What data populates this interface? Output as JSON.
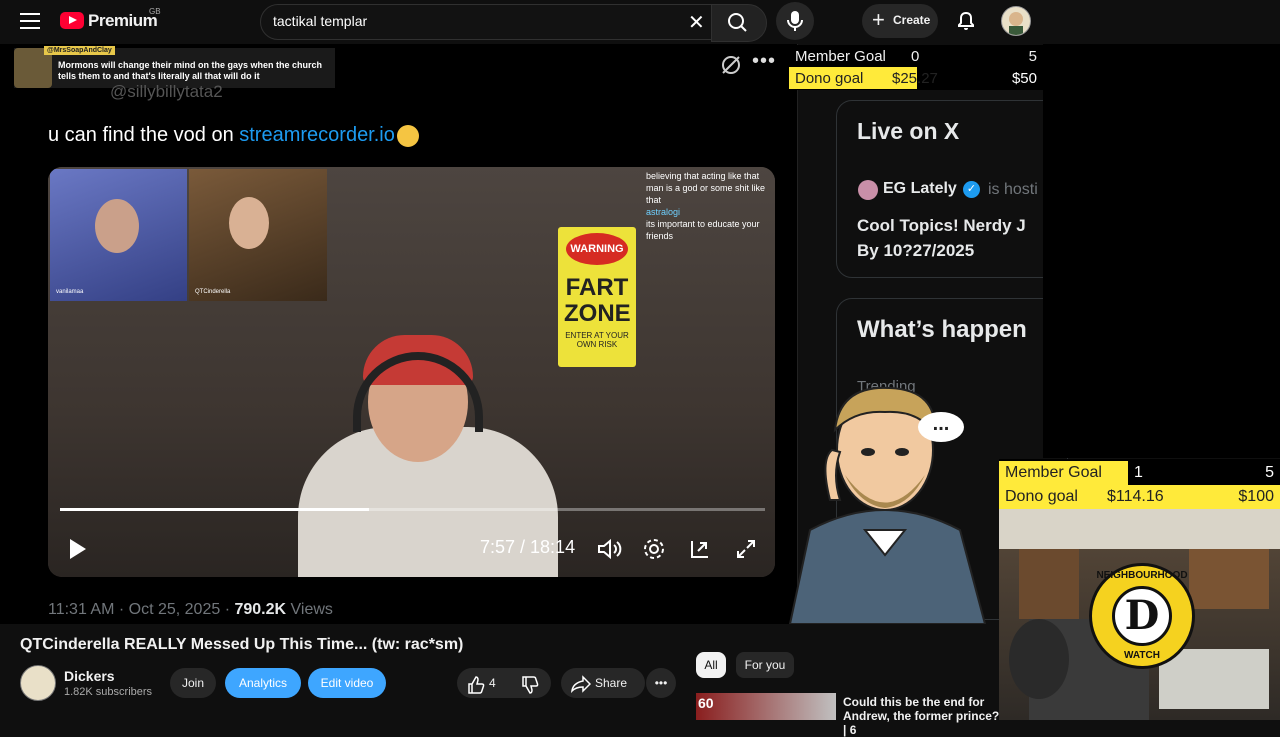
{
  "topbar": {
    "brand": "Premium",
    "region": "GB",
    "search_value": "tactikal templar",
    "create_label": "Create"
  },
  "stream": {
    "chat_user": "@MrsSoapAndClay",
    "chat_message": "Mormons will change their mind on the gays when the church tells them to and that's literally all that will do it",
    "post_handle": "@sillybillytata2",
    "post_text": "u can find the vod on ",
    "post_link": "streamrecorder.io",
    "overlay_chat": "believing that acting like that man is a god or some shit like that",
    "overlay_chat_user": "astralogi",
    "overlay_chat2": "its important to educate your friends",
    "sign_top": "WARNING",
    "sign_main": "FART ZONE",
    "sign_bottom": "ENTER AT YOUR OWN RISK",
    "thumb1_label": "vanilamaa",
    "thumb2_label": "QTCinderella",
    "time_current": "7:57",
    "time_total": "18:14",
    "time_display": "7:57 / 18:14",
    "progress": 0.438,
    "post_time": "11:31 AM · Oct 25, 2025 · ",
    "views_count": "790.2K",
    "views_label": " Views"
  },
  "x_panel": {
    "live_title": "Live on X",
    "host_name": "EG Lately",
    "host_status": "is hosti",
    "space_title": "Cool Topics! Nerdy J By 10?27/2025",
    "whats_happening": "What’s happen",
    "trending_label": "Trending"
  },
  "goals_top": {
    "member_label": "Member Goal",
    "member_current": "0",
    "member_target": "5",
    "dono_label": "Dono goal",
    "dono_current": "$25.27",
    "dono_target": "$50"
  },
  "goals_bottom": {
    "member_label": "Member Goal",
    "member_current": "1",
    "member_target": "5",
    "dono_label": "Dono goal",
    "dono_current": "$114.16",
    "dono_target": "$100"
  },
  "bubble_text": "...",
  "badge": {
    "top": "NEIGHBOURHOOD",
    "letter": "D",
    "bottom": "WATCH"
  },
  "video": {
    "title": "QTCinderella REALLY Messed Up This Time... (tw: rac*sm)",
    "channel": "Dickers",
    "subscribers": "1.82K subscribers",
    "join_label": "Join",
    "analytics_label": "Analytics",
    "edit_label": "Edit video",
    "like_count": "4",
    "share_label": "Share"
  },
  "side": {
    "tabs": [
      "All",
      "For you"
    ],
    "rec_title": "Could this be the end for Andrew, the former prince? | 6",
    "rec_channel_badge": "60"
  },
  "colors": {
    "youtube_red": "#ff0033",
    "goal_yellow": "#ffea3a",
    "accent_blue": "#3ea6ff",
    "x_blue": "#1d9bf0"
  }
}
